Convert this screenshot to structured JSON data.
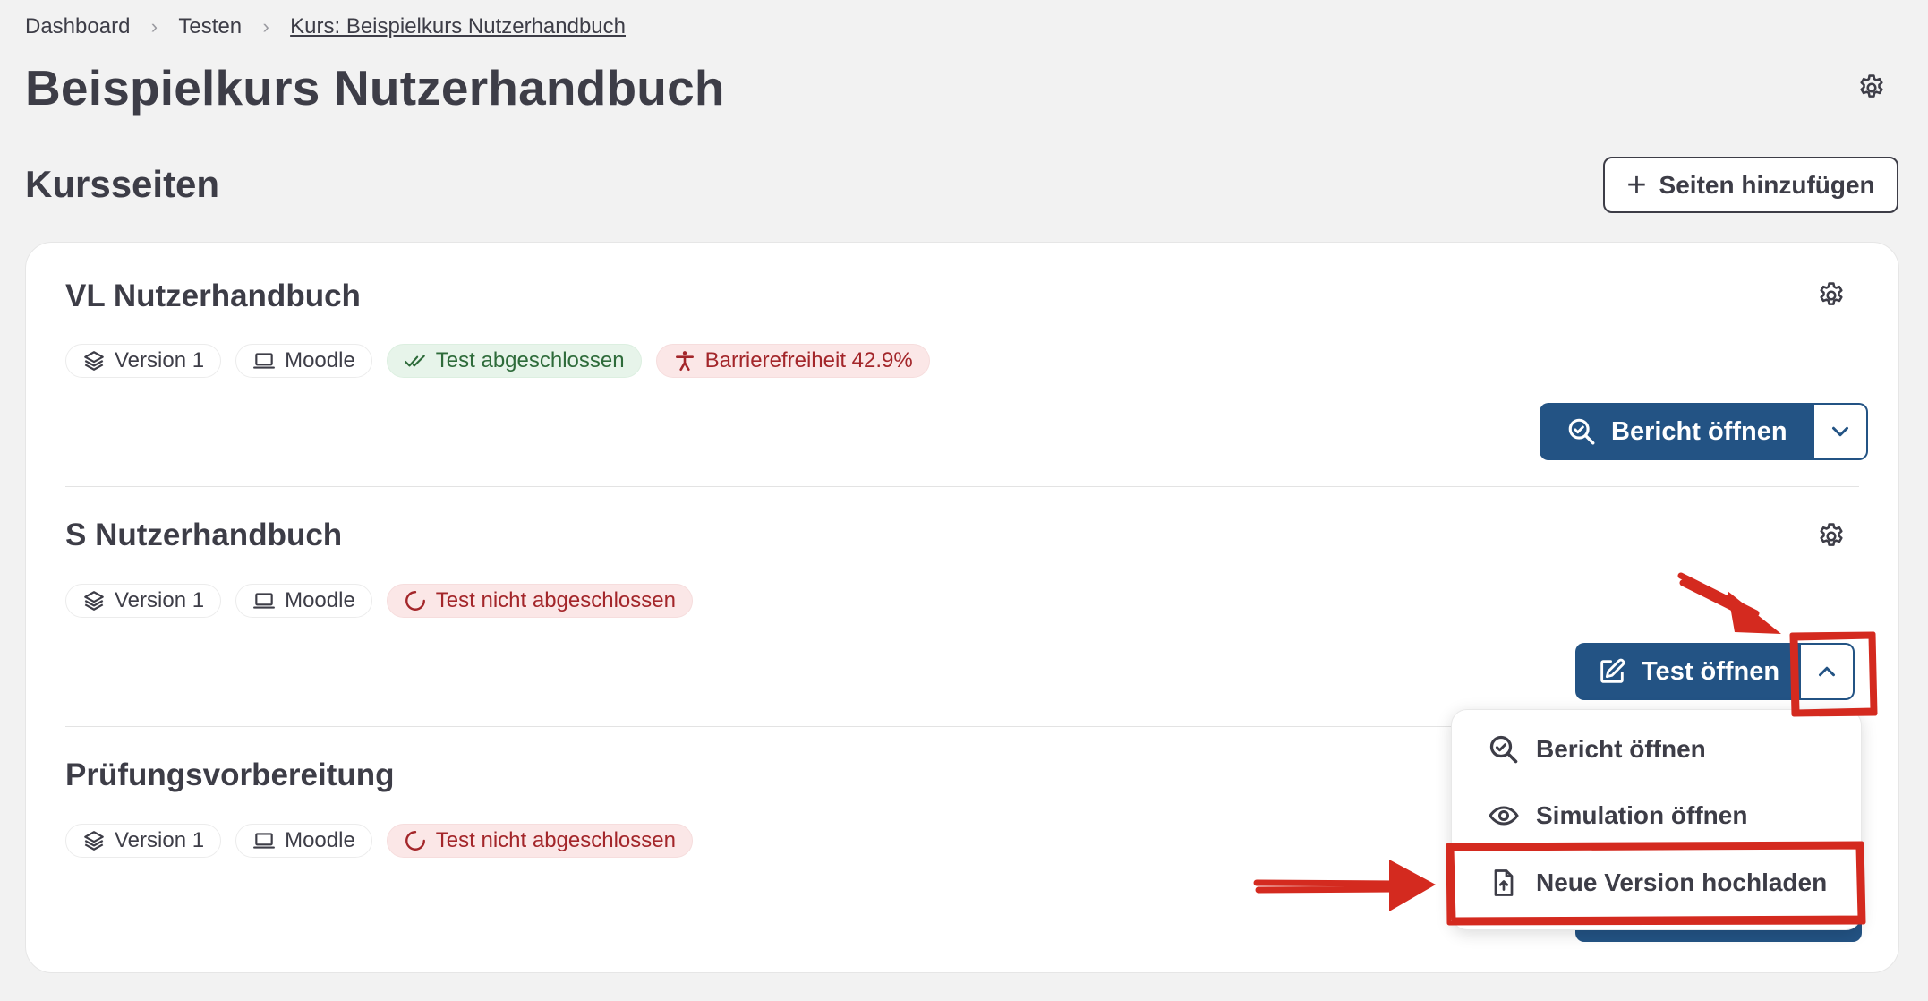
{
  "breadcrumb": {
    "items": [
      "Dashboard",
      "Testen"
    ],
    "current": "Kurs: Beispielkurs Nutzerhandbuch"
  },
  "page": {
    "title": "Beispielkurs Nutzerhandbuch"
  },
  "section": {
    "title": "Kursseiten",
    "add_button": "Seiten hinzufügen"
  },
  "courses": [
    {
      "title": "VL Nutzerhandbuch",
      "badges": {
        "version": "Version 1",
        "platform": "Moodle",
        "status": "Test abgeschlossen",
        "accessibility": "Barrierefreiheit 42.9%"
      },
      "action": "Bericht öffnen"
    },
    {
      "title": "S Nutzerhandbuch",
      "badges": {
        "version": "Version 1",
        "platform": "Moodle",
        "status": "Test nicht abgeschlossen"
      },
      "action": "Test öffnen"
    },
    {
      "title": "Prüfungsvorbereitung",
      "badges": {
        "version": "Version 1",
        "platform": "Moodle",
        "status": "Test nicht abgeschlossen"
      }
    }
  ],
  "dropdown": {
    "items": [
      {
        "label": "Bericht öffnen",
        "icon": "search-report-icon"
      },
      {
        "label": "Simulation öffnen",
        "icon": "eye-icon"
      },
      {
        "label": "Neue Version hochladen",
        "icon": "file-upload-icon"
      }
    ]
  },
  "colors": {
    "primary": "#235384",
    "success_bg": "#e7f4ea",
    "success_text": "#2e6b3a",
    "danger_bg": "#fbe7e7",
    "danger_text": "#a3262a",
    "annotation": "#d42a1f"
  }
}
